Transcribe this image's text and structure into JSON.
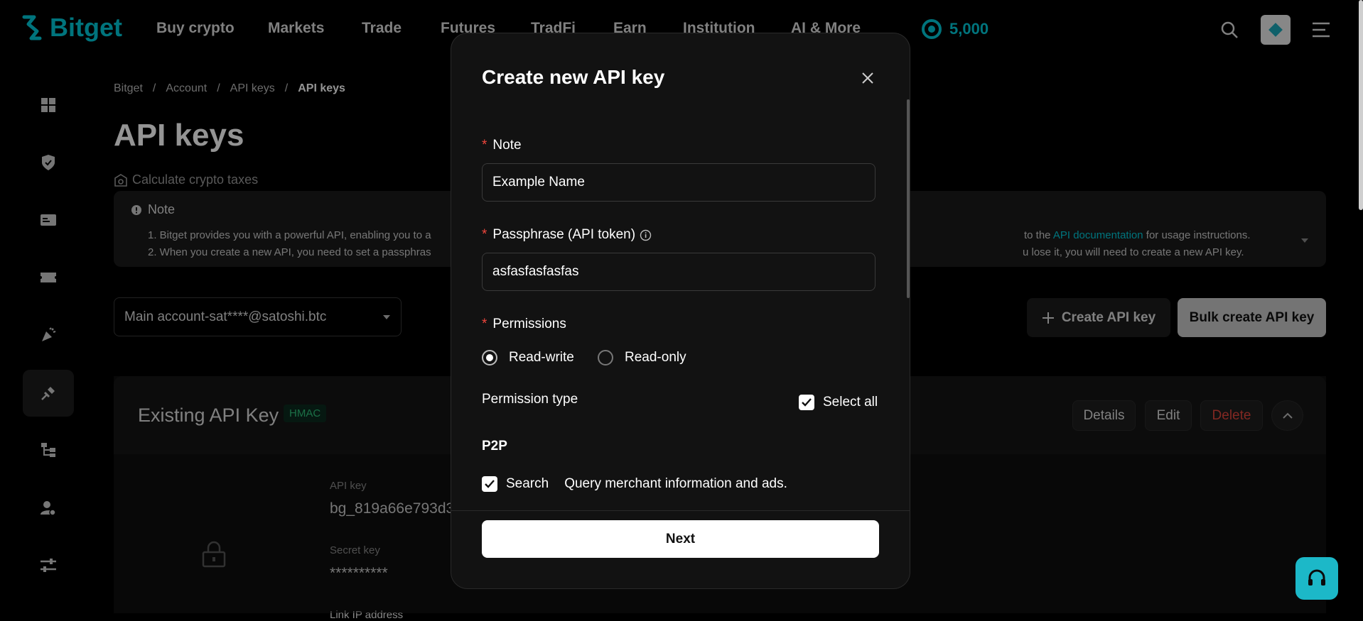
{
  "brand": {
    "name": "Bitget",
    "accent": "#00c8d7"
  },
  "nav": {
    "items": [
      "Buy crypto",
      "Markets",
      "Trade",
      "Futures",
      "TradFi",
      "Earn",
      "Institution",
      "AI & More"
    ],
    "points": "5,000"
  },
  "breadcrumb": [
    "Bitget",
    "Account",
    "API keys",
    "API keys"
  ],
  "page": {
    "title": "API keys",
    "tax_link": "Calculate crypto taxes",
    "note_title": "Note",
    "note_line1_start": "1.  Bitget provides you with a powerful API, enabling you to a",
    "note_line1_end_pre": "to the ",
    "note_line1_link": "API documentation",
    "note_line1_end_post": " for usage instructions.",
    "note_line2_start": "2.  When you create a new API, you need to set a passphras",
    "note_line2_end": "u lose it, you will need to create a new API key.",
    "account_select": "Main account-sat****@satoshi.btc",
    "create_button": "Create API key",
    "bulk_button": "Bulk create API key"
  },
  "existing": {
    "title": "Existing API Key",
    "badge": "HMAC",
    "details": "Details",
    "edit": "Edit",
    "delete": "Delete",
    "api_key_label": "API key",
    "api_key_value": "bg_819a66e793d3",
    "secret_label": "Secret key",
    "secret_value": "**********",
    "ip_label": "Link IP address"
  },
  "modal": {
    "title": "Create new API key",
    "note_label": "Note",
    "note_value": "Example Name",
    "passphrase_label": "Passphrase (API token)",
    "passphrase_value": "asfasfasfasfas",
    "permissions_label": "Permissions",
    "radio_rw": "Read-write",
    "radio_ro": "Read-only",
    "selected_permission": "Read-write",
    "permission_type": "Permission type",
    "select_all": "Select all",
    "section_p2p": "P2P",
    "search_label": "Search",
    "search_desc": "Query merchant information and ads.",
    "next_button": "Next"
  },
  "icons": {
    "logo": "bitget-logo-icon",
    "search": "search-icon",
    "menu": "menu-icon",
    "close": "close-icon",
    "support": "headset-icon"
  }
}
